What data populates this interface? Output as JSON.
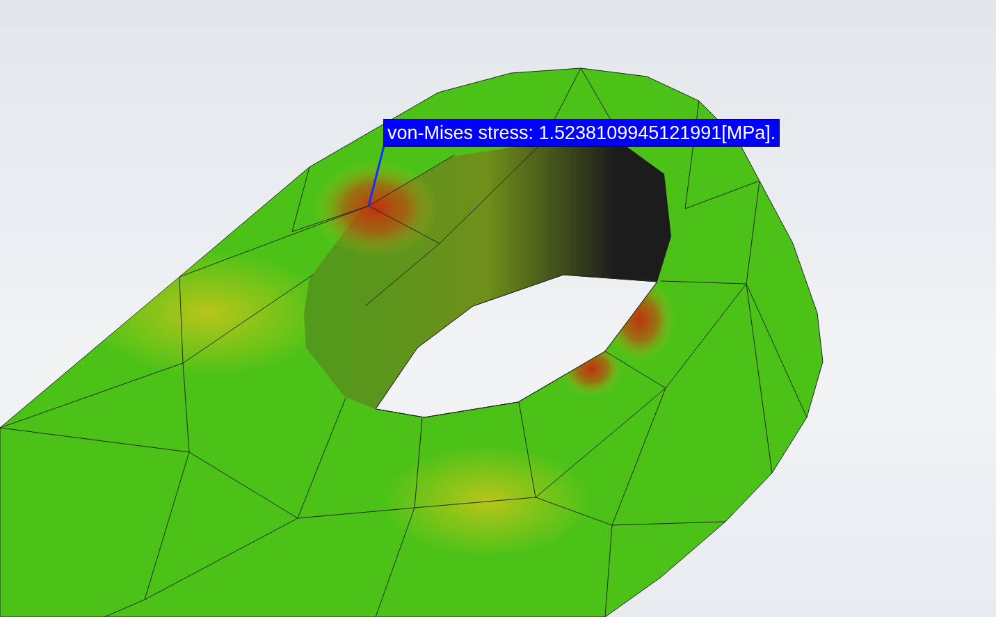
{
  "viewport": {
    "annotation": {
      "text": "von-Mises stress: 1.5238109945121991[MPa]."
    }
  }
}
